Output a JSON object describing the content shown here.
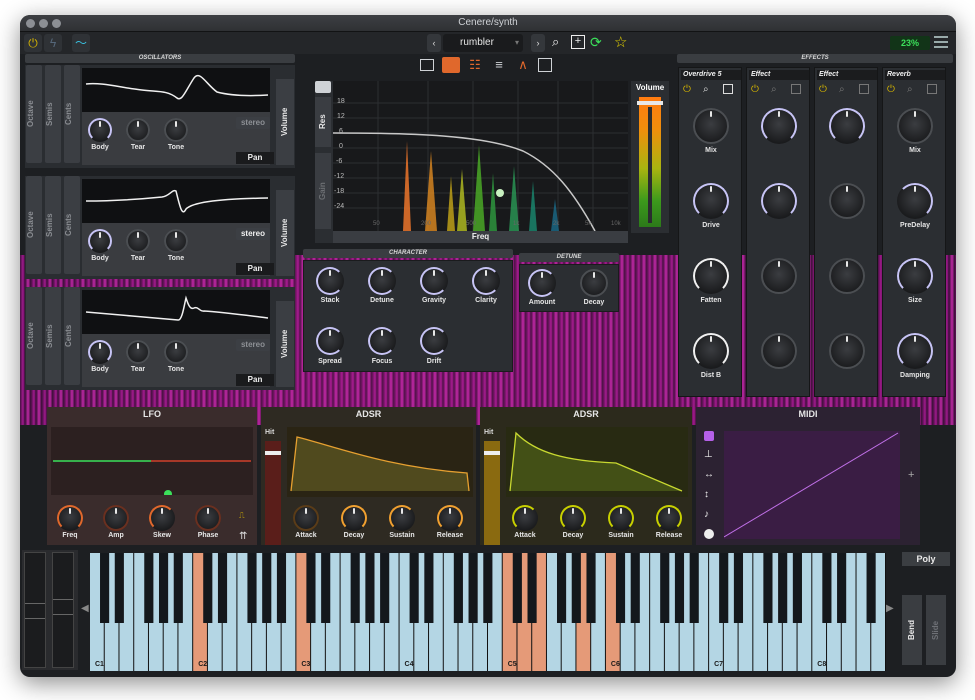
{
  "window": {
    "title": "Cenere/synth"
  },
  "toolbar": {
    "preset_name": "rumbler",
    "prev": "‹",
    "next": "›",
    "cpu": "23%"
  },
  "oscillators": {
    "title": "OSCILLATORS",
    "side_labels": [
      "Octave",
      "Semis",
      "Cents"
    ],
    "knob_labels": [
      "Body",
      "Tear",
      "Tone"
    ],
    "volume": "Volume",
    "pan": "Pan",
    "stereo": [
      "stereo",
      "stereo",
      "stereo"
    ]
  },
  "filter": {
    "res_label": "Res",
    "gain_label": "Gain",
    "freq_label": "Freq",
    "db_ticks": [
      "18",
      "12",
      "6",
      "0",
      "-6",
      "-12",
      "-18",
      "-24"
    ],
    "freq_ticks": [
      "50",
      "200",
      "500",
      "1k",
      "2k",
      "5k",
      "10k"
    ]
  },
  "volume_panel": {
    "label": "Volume"
  },
  "character": {
    "title": "CHARACTER",
    "knobs": [
      "Stack",
      "Detune",
      "Gravity",
      "Clarity",
      "Spread",
      "Focus",
      "Drift"
    ]
  },
  "detune": {
    "title": "DETUNE",
    "knobs": [
      "Amount",
      "Decay"
    ]
  },
  "effects": {
    "title": "EFFECTS",
    "slots": [
      {
        "name": "Overdrive 5",
        "knobs": [
          "Mix",
          "Drive",
          "Fatten",
          "Dist B"
        ]
      },
      {
        "name": "Effect",
        "knobs": [
          "",
          "",
          "",
          ""
        ]
      },
      {
        "name": "Effect",
        "knobs": [
          "",
          "",
          "",
          ""
        ]
      },
      {
        "name": "Reverb",
        "knobs": [
          "Mix",
          "PreDelay",
          "Size",
          "Damping"
        ]
      }
    ]
  },
  "lfo": {
    "title": "LFO",
    "knobs": [
      "Freq",
      "Amp",
      "Skew",
      "Phase"
    ]
  },
  "adsr1": {
    "title": "ADSR",
    "hit": "Hit",
    "knobs": [
      "Attack",
      "Decay",
      "Sustain",
      "Release"
    ]
  },
  "adsr2": {
    "title": "ADSR",
    "hit": "Hit",
    "knobs": [
      "Attack",
      "Decay",
      "Sustain",
      "Release"
    ]
  },
  "midi": {
    "title": "MIDI",
    "plus": "+"
  },
  "keyboard": {
    "octave_labels": [
      "C1",
      "C2",
      "C3",
      "C4",
      "C5",
      "C6",
      "C7",
      "C8"
    ],
    "mode": "Poly",
    "bend": "Bend",
    "slide": "Slide"
  },
  "colors": {
    "orange": "#e0682c",
    "yellow": "#d5b400",
    "green": "#3be05a",
    "purple": "#b560e8",
    "lavender": "#c7c4f5"
  }
}
